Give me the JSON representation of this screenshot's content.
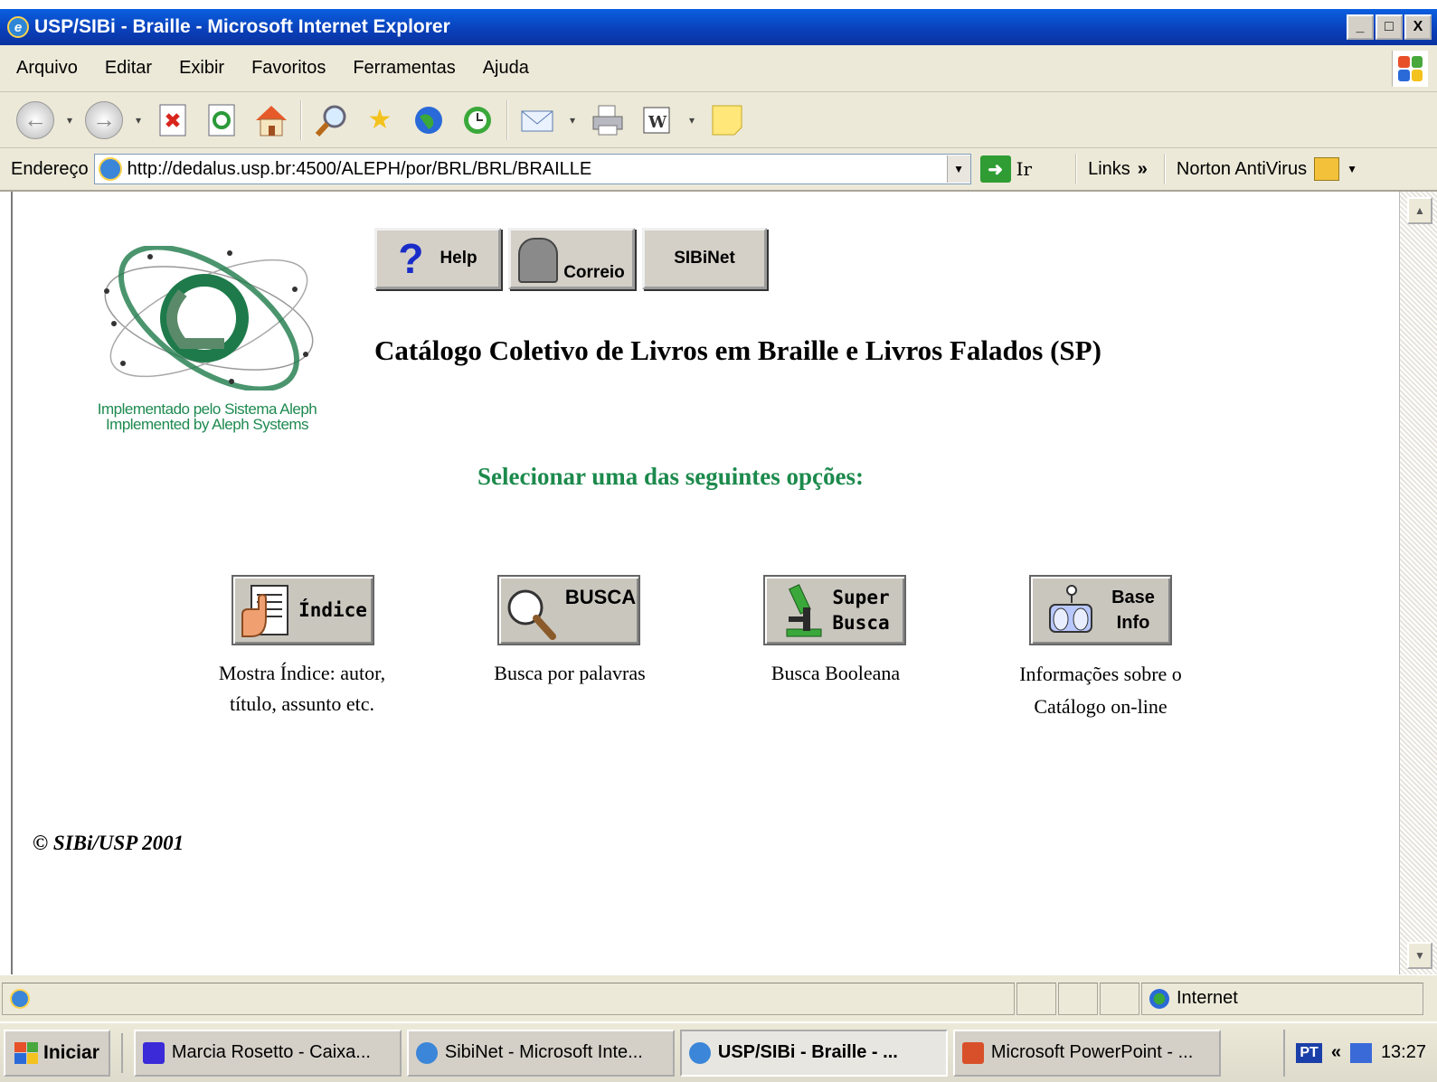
{
  "window": {
    "title": "USP/SIBi - Braille - Microsoft Internet Explorer",
    "controls": [
      "_",
      "□",
      "X"
    ]
  },
  "menu": [
    "Arquivo",
    "Editar",
    "Exibir",
    "Favoritos",
    "Ferramentas",
    "Ajuda"
  ],
  "toolbar": {
    "icons": [
      "back-icon",
      "forward-icon",
      "stop-icon",
      "refresh-icon",
      "home-icon",
      "search-icon",
      "favorites-icon",
      "media-icon",
      "history-icon",
      "mail-icon",
      "print-icon",
      "word-icon",
      "messenger-icon"
    ]
  },
  "address": {
    "label": "Endereço",
    "url": "http://dedalus.usp.br:4500/ALEPH/por/BRL/BRL/BRAILLE",
    "go": "Ir",
    "links": "Links",
    "links_chevron": "»",
    "norton": "Norton AntiVirus"
  },
  "page": {
    "logo_caption_1": "Implementado pelo Sistema Aleph",
    "logo_caption_2": "Implemented by Aleph Systems",
    "top_buttons": {
      "help": "Help",
      "correio": "Correio",
      "sibinet": "SIBiNet"
    },
    "title": "Catálogo Coletivo de Livros em Braille e Livros Falados (SP)",
    "select_label": "Selecionar uma das seguintes opções:",
    "options": [
      {
        "label": "Índice",
        "desc_1": "Mostra Índice: autor,",
        "desc_2": "título, assunto etc."
      },
      {
        "label": "BUSCA",
        "desc_1": "Busca por palavras",
        "desc_2": ""
      },
      {
        "label_1": "Super",
        "label_2": "Busca",
        "desc_1": "Busca Booleana",
        "desc_2": ""
      },
      {
        "label_1": "Base",
        "label_2": "Info",
        "desc_1": "Informações sobre o",
        "desc_2": "Catálogo on-line"
      }
    ],
    "copyright": "© SIBi/USP 2001"
  },
  "status": {
    "zone": "Internet"
  },
  "taskbar": {
    "start": "Iniciar",
    "tasks": [
      "Marcia Rosetto - Caixa...",
      "SibiNet - Microsoft Inte...",
      "USP/SIBi - Braille - ...",
      "Microsoft PowerPoint - ..."
    ],
    "lang": "PT",
    "chevron": "«",
    "clock": "13:27"
  }
}
